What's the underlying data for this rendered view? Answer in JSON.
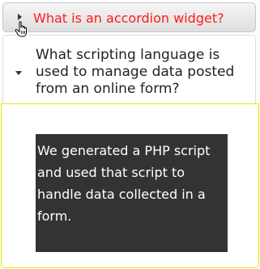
{
  "accordion": {
    "section1": {
      "title": "What is an accordion widget?",
      "expanded": false,
      "title_color": "#ff1b1b"
    },
    "section2": {
      "title": "What scripting language is used to manage data posted from an online form?",
      "expanded": true,
      "content": "We generated a PHP script and used that script to handle data collected in a form."
    }
  },
  "icons": {
    "collapsed_indicator": "triangle-right-icon",
    "expanded_indicator": "triangle-down-icon",
    "cursor": "hand-pointer-cursor"
  },
  "colors": {
    "panel_border": "#e8e800",
    "content_background": "#333333",
    "content_text": "#ffffff"
  }
}
